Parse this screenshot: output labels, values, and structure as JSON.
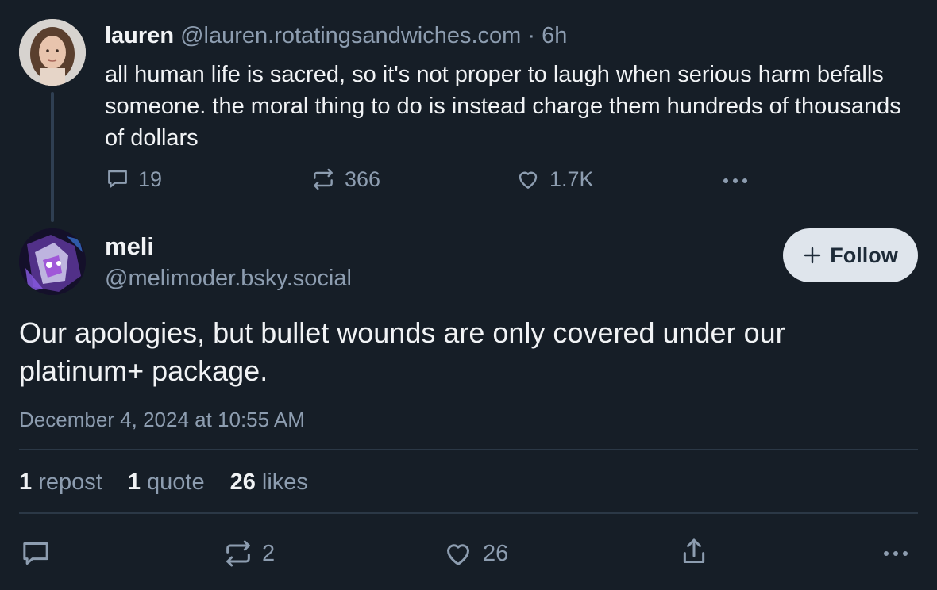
{
  "parent_post": {
    "display_name": "lauren",
    "handle": "@lauren.rotatingsandwiches.com",
    "separator": "·",
    "age": "6h",
    "text": "all human life is sacred, so it's not proper to laugh when serious harm befalls someone. the moral thing to do is instead charge them hundreds of thousands of dollars",
    "actions": {
      "reply_count": "19",
      "repost_count": "366",
      "like_count": "1.7K",
      "more_icon": "ellipsis-icon"
    }
  },
  "reply_post": {
    "display_name": "meli",
    "handle": "@melimoder.bsky.social",
    "follow_label": "Follow",
    "follow_icon": "plus-icon",
    "text": "Our apologies, but bullet wounds are only covered under our platinum+ package.",
    "timestamp": "December 4, 2024 at 10:55 AM",
    "stats": {
      "reposts_count": "1",
      "reposts_label": "repost",
      "quotes_count": "1",
      "quotes_label": "quote",
      "likes_count": "26",
      "likes_label": "likes"
    },
    "actions": {
      "reply_count": "",
      "repost_count": "2",
      "like_count": "26",
      "share_icon": "share-icon",
      "more_icon": "ellipsis-icon"
    }
  },
  "colors": {
    "background": "#161e27",
    "text_primary": "#f1f3f5",
    "text_muted": "#8d9db0",
    "thread_line": "#2f3f52",
    "divider": "#2b3846",
    "follow_button_bg": "#dfe5ec"
  }
}
